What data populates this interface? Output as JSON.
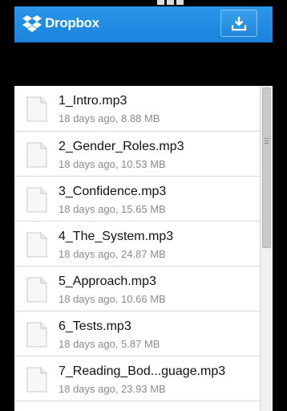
{
  "app": {
    "title": "Dropbox"
  },
  "colors": {
    "appbar": "#1f8ce6",
    "text_primary": "#111111",
    "text_secondary": "#8a8a8a"
  },
  "icons": {
    "logo": "dropbox-logo-icon",
    "upload": "download-tray-icon",
    "file": "document-icon"
  },
  "files": [
    {
      "name": "1_Intro.mp3",
      "meta": "18 days ago, 8.88 MB"
    },
    {
      "name": "2_Gender_Roles.mp3",
      "meta": "18 days ago, 10.53 MB"
    },
    {
      "name": "3_Confidence.mp3",
      "meta": "18 days ago, 15.65 MB"
    },
    {
      "name": "4_The_System.mp3",
      "meta": "18 days ago, 24.87 MB"
    },
    {
      "name": "5_Approach.mp3",
      "meta": "18 days ago, 10.66 MB"
    },
    {
      "name": "6_Tests.mp3",
      "meta": "18 days ago, 5.87 MB"
    },
    {
      "name": "7_Reading_Bod...guage.mp3",
      "meta": "18 days ago, 23.93 MB"
    }
  ]
}
